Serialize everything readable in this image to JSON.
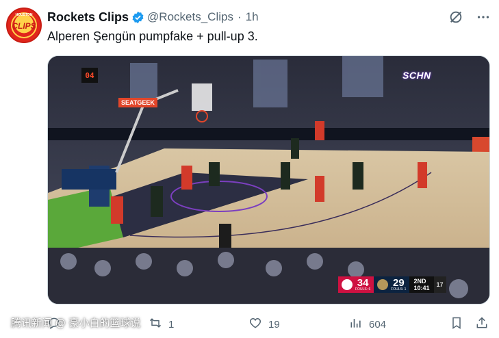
{
  "tweet": {
    "author": "Rockets Clips",
    "handle": "@Rockets_Clips",
    "separator": "·",
    "time": "1h",
    "text": "Alperen Şengün pumpfake + pull-up 3.",
    "avatar_text": "CLIPS",
    "avatar_top_text": "HOUSTON"
  },
  "media": {
    "broadcast_logo": "SCHN",
    "shot_clock": "04",
    "arena_ad": "SEATGEEK",
    "scorebug": {
      "home_team": "HOU",
      "home_score": "34",
      "home_fouls": "FOULS: 6",
      "away_team": "NOP",
      "away_score": "29",
      "away_fouls": "FOULS: 1",
      "period": "2ND",
      "clock": "10:41",
      "shot": "17",
      "home_color": "#ce1141",
      "away_color": "#0c2340"
    }
  },
  "actions": {
    "replies": "",
    "reposts": "1",
    "likes": "19",
    "views": "604"
  },
  "watermark": "腾讯新闻 @ 豪小白的篮球说",
  "colors": {
    "verified": "#1d9bf0",
    "muted": "#536471",
    "rockets_red": "#ce1141"
  },
  "icons": [
    "verified-icon",
    "grok-icon",
    "more-icon",
    "reply-icon",
    "repost-icon",
    "like-icon",
    "views-icon",
    "bookmark-icon",
    "share-icon"
  ]
}
